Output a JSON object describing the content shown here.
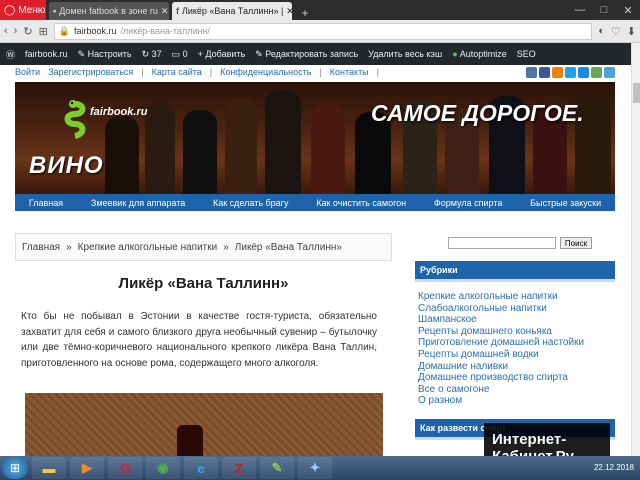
{
  "browser": {
    "menu_label": "Меню",
    "tabs": [
      {
        "label": "Домен fatbook в зоне ru",
        "active": false
      },
      {
        "label": "Ликёр «Вана Таллинн» |",
        "active": true
      }
    ],
    "url_host": "fairbook.ru",
    "url_path": "/ликёр-вана-таллинн/",
    "window_controls": [
      "—",
      "□",
      "✕"
    ]
  },
  "wp_admin_bar": {
    "items": [
      "fairbook.ru",
      "Настроить",
      "37",
      "0",
      "+ Добавить",
      "Редактировать запись",
      "Удалить весь кэш",
      "Autoptimize",
      "SEO"
    ]
  },
  "top_nav": {
    "login": "Войти",
    "register": "Зарегистрироваться",
    "links": [
      "Карта сайта",
      "Конфиденциальность",
      "Контакты"
    ]
  },
  "banner": {
    "site_name": "fairbook.ru",
    "word": "ВИНО",
    "tagline": "САМОЕ ДОРОГОЕ."
  },
  "main_nav": [
    "Главная",
    "Змеевик для аппарата",
    "Как сделать брагу",
    "Как очистить самогон",
    "Формула спирта",
    "Быстрые закуски"
  ],
  "breadcrumb": {
    "items": [
      "Главная",
      "Крепкие алкогольные напитки",
      "Ликёр «Вана Таллинн»"
    ],
    "separator": "»"
  },
  "article": {
    "title": "Ликёр «Вана Таллинн»",
    "intro": "Кто бы не побывал в Эстонии в качестве гостя-туриста, обязательно захватит для себя и самого близкого друга необычный сувенир – бутылочку или две тёмно-коричневого национального крепкого ликёра Вана Таллин, приготовленного на основе рома, содержащего много алкоголя."
  },
  "sidebar": {
    "search_button": "Поиск",
    "rubrics_title": "Рубрики",
    "categories": [
      "Крепкие алкогольные напитки",
      "Слабоалкогольные напитки",
      "Шампанское",
      "Рецепты домашнего коньяка",
      "Приготовление домашней настойки",
      "Рецепты домашней водки",
      "Домашние наливки",
      "Домашнее производство спирта",
      "Все о самогоне",
      "О разном"
    ],
    "second_widget_title": "Как развести спирт"
  },
  "overlay": {
    "line1": "Интернет-",
    "line2": "Кабинет.Ру"
  },
  "taskbar": {
    "date": "22.12.2018"
  },
  "colors": {
    "accent_blue": "#1e64ad",
    "link_blue": "#2a6fb5",
    "opera_red": "#e01e2b"
  }
}
